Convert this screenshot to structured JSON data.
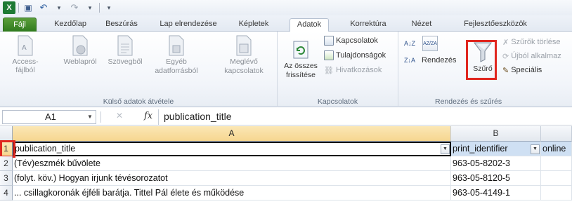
{
  "qat": {
    "logo_glyph": "X",
    "save_glyph": "▣",
    "undo_glyph": "↶",
    "redo_glyph": "↷",
    "customize_glyph": "▾"
  },
  "tabs": [
    {
      "label": "Fájl"
    },
    {
      "label": "Kezdőlap"
    },
    {
      "label": "Beszúrás"
    },
    {
      "label": "Lap elrendezése"
    },
    {
      "label": "Képletek"
    },
    {
      "label": "Adatok"
    },
    {
      "label": "Korrektúra"
    },
    {
      "label": "Nézet"
    },
    {
      "label": "Fejlesztőeszközök"
    }
  ],
  "active_tab": "Adatok",
  "ribbon": {
    "external": {
      "group_label": "Külső adatok átvétele",
      "access": "Access-fájlból",
      "web": "Weblapról",
      "text": "Szövegből",
      "other_line1": "Egyéb",
      "other_line2": "adatforrásból",
      "existing_line1": "Meglévő",
      "existing_line2": "kapcsolatok"
    },
    "connections": {
      "group_label": "Kapcsolatok",
      "refresh_line1": "Az összes",
      "refresh_line2": "frissítése",
      "connections": "Kapcsolatok",
      "properties": "Tulajdonságok",
      "links": "Hivatkozások"
    },
    "sortfilter": {
      "group_label": "Rendezés és szűrés",
      "sort_az_glyph": "A↓Z",
      "sort_dialog_glyph": "AZ/ZA",
      "sort_za_glyph": "Z↓A",
      "sort": "Rendezés",
      "filter": "Szűrő",
      "clear": "Szűrők törlése",
      "reapply": "Újból alkalmaz",
      "advanced": "Speciális"
    }
  },
  "formula_bar": {
    "name_box": "A1",
    "name_box_arrow": "▼",
    "cancel_glyph": "✕",
    "fx_label": "fx",
    "content": "publication_title"
  },
  "columns": [
    {
      "label": "A"
    },
    {
      "label": "B"
    },
    {
      "label": ""
    }
  ],
  "rows": [
    {
      "num": "1",
      "a": "publication_title",
      "b": "print_identifier",
      "c": "online"
    },
    {
      "num": "2",
      "a": "(Tév)eszmék bűvölete",
      "b": "963-05-8202-3",
      "c": ""
    },
    {
      "num": "3",
      "a": "(folyt. köv.) Hogyan irjunk tévésorozatot",
      "b": "963-05-8120-5",
      "c": ""
    },
    {
      "num": "4",
      "a": "... csillagkoronák éjféli barátja. Tittel Pál élete és működése",
      "b": "963-05-4149-1",
      "c": ""
    }
  ],
  "filter_arrow_glyph": "▼",
  "colors": {
    "highlight": "#e0261f",
    "file_tab": "#2f7a1e",
    "selected_header": "#f6d690",
    "filter_header_fill": "#cfe0f3"
  }
}
